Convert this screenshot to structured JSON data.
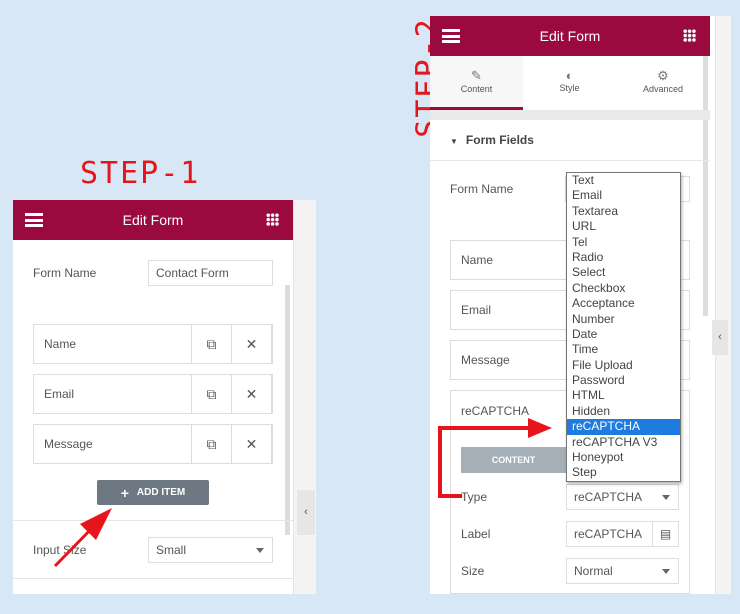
{
  "step1": {
    "label": "STEP-1",
    "header_title": "Edit Form",
    "form_name_label": "Form Name",
    "form_name_value": "Contact Form",
    "items": [
      {
        "label": "Name"
      },
      {
        "label": "Email"
      },
      {
        "label": "Message"
      }
    ],
    "add_item_label": "ADD ITEM",
    "input_size_label": "Input Size",
    "input_size_value": "Small"
  },
  "step2": {
    "label": "STEP-2",
    "header_title": "Edit Form",
    "tabs": [
      {
        "label": "Content",
        "icon": "pencil-icon",
        "active": true
      },
      {
        "label": "Style",
        "icon": "half-circle-icon"
      },
      {
        "label": "Advanced",
        "icon": "gear-icon"
      }
    ],
    "section_title": "Form Fields",
    "form_name_label": "Form Name",
    "items": [
      {
        "label": "Name"
      },
      {
        "label": "Email"
      },
      {
        "label": "Message"
      },
      {
        "label": "reCAPTCHA"
      }
    ],
    "inner_tab": "CONTENT",
    "type_label": "Type",
    "type_value": "reCAPTCHA",
    "field_label_label": "Label",
    "field_label_value": "reCAPTCHA",
    "size_label": "Size",
    "size_value": "Normal",
    "dropdown_options": [
      "Text",
      "Email",
      "Textarea",
      "URL",
      "Tel",
      "Radio",
      "Select",
      "Checkbox",
      "Acceptance",
      "Number",
      "Date",
      "Time",
      "File Upload",
      "Password",
      "HTML",
      "Hidden",
      "reCAPTCHA",
      "reCAPTCHA V3",
      "Honeypot",
      "Step"
    ],
    "dropdown_selected": "reCAPTCHA"
  },
  "colors": {
    "header": "#9b0a3e",
    "annotation": "#e8141c",
    "selected": "#1e7be0"
  }
}
